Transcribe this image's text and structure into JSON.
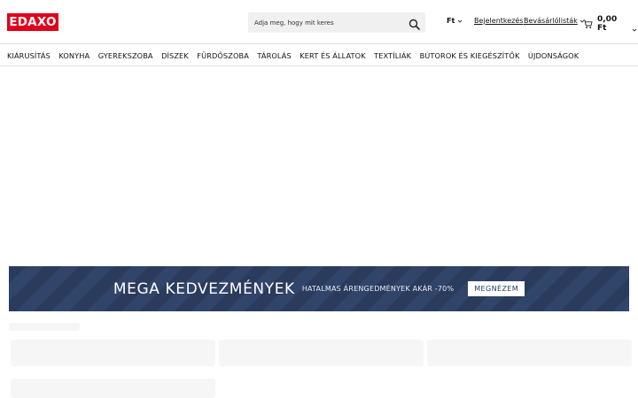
{
  "header": {
    "logo_text": "EDAXO",
    "search": {
      "placeholder": "Adja meg, hogy mit keres",
      "icon": "search-icon"
    },
    "currency": "Ft",
    "login": "Bejelentkezés",
    "shopping_lists": "Bevásárlólisták",
    "cart_total": "0,00 Ft",
    "brand_color": "#e2001a"
  },
  "nav": {
    "items": [
      "KIÁRUSÍTÁS",
      "KONYHA",
      "GYEREKSZOBA",
      "DÍSZEK",
      "FÜRDŐSZOBA",
      "TÁROLÁS",
      "KERT ÉS ÁLLATOK",
      "TEXTÍLIÁK",
      "BÚTOROK ÉS KIEGÉSZÍTŐK",
      "ÚJDONSÁGOK"
    ]
  },
  "banner": {
    "title": "MEGA KEDVEZMÉNYEK",
    "subtitle": "HATALMAS ÁRENGEDMÉNYEK AKÁR -70%",
    "button": "MEGNÉZEM",
    "background_color": "#2a3b5c"
  }
}
